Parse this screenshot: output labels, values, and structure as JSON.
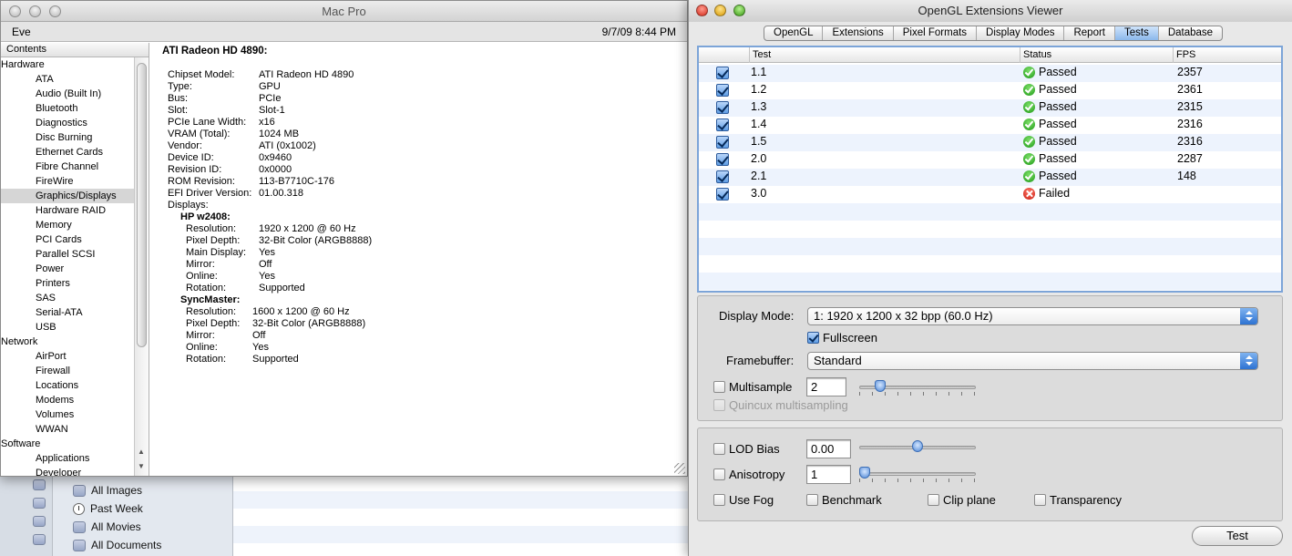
{
  "background_finder": {
    "items": [
      {
        "label": "All Images",
        "icon": "smart-folder-icon"
      },
      {
        "label": "Past Week",
        "icon": "clock-icon"
      },
      {
        "label": "All Movies",
        "icon": "smart-folder-icon"
      },
      {
        "label": "All Documents",
        "icon": "smart-folder-icon"
      }
    ]
  },
  "system_profiler": {
    "title": "Mac Pro",
    "user": "Eve",
    "datetime": "9/7/09 8:44 PM",
    "contents_header": "Contents",
    "sidebar": [
      {
        "label": "Hardware",
        "type": "category"
      },
      {
        "label": "ATA",
        "type": "item"
      },
      {
        "label": "Audio (Built In)",
        "type": "item"
      },
      {
        "label": "Bluetooth",
        "type": "item"
      },
      {
        "label": "Diagnostics",
        "type": "item"
      },
      {
        "label": "Disc Burning",
        "type": "item"
      },
      {
        "label": "Ethernet Cards",
        "type": "item"
      },
      {
        "label": "Fibre Channel",
        "type": "item"
      },
      {
        "label": "FireWire",
        "type": "item"
      },
      {
        "label": "Graphics/Displays",
        "type": "item",
        "selected": true
      },
      {
        "label": "Hardware RAID",
        "type": "item"
      },
      {
        "label": "Memory",
        "type": "item"
      },
      {
        "label": "PCI Cards",
        "type": "item"
      },
      {
        "label": "Parallel SCSI",
        "type": "item"
      },
      {
        "label": "Power",
        "type": "item"
      },
      {
        "label": "Printers",
        "type": "item"
      },
      {
        "label": "SAS",
        "type": "item"
      },
      {
        "label": "Serial-ATA",
        "type": "item"
      },
      {
        "label": "USB",
        "type": "item"
      },
      {
        "label": "Network",
        "type": "category"
      },
      {
        "label": "AirPort",
        "type": "item"
      },
      {
        "label": "Firewall",
        "type": "item"
      },
      {
        "label": "Locations",
        "type": "item"
      },
      {
        "label": "Modems",
        "type": "item"
      },
      {
        "label": "Volumes",
        "type": "item"
      },
      {
        "label": "WWAN",
        "type": "item"
      },
      {
        "label": "Software",
        "type": "category"
      },
      {
        "label": "Applications",
        "type": "item"
      },
      {
        "label": "Developer",
        "type": "item"
      }
    ],
    "detail": {
      "title": "ATI Radeon HD 4890:",
      "rows": [
        {
          "k": "Chipset Model:",
          "v": "ATI Radeon HD 4890"
        },
        {
          "k": "Type:",
          "v": "GPU"
        },
        {
          "k": "Bus:",
          "v": "PCIe"
        },
        {
          "k": "Slot:",
          "v": "Slot-1"
        },
        {
          "k": "PCIe Lane Width:",
          "v": "x16"
        },
        {
          "k": "VRAM (Total):",
          "v": "1024 MB"
        },
        {
          "k": "Vendor:",
          "v": "ATI (0x1002)"
        },
        {
          "k": "Device ID:",
          "v": "0x9460"
        },
        {
          "k": "Revision ID:",
          "v": "0x0000"
        },
        {
          "k": "ROM Revision:",
          "v": "113-B7710C-176"
        },
        {
          "k": "EFI Driver Version:",
          "v": "01.00.318"
        }
      ],
      "displays_label": "Displays:",
      "displays": [
        {
          "name": "HP w2408:",
          "rows": [
            {
              "k": "Resolution:",
              "v": "1920 x 1200 @ 60 Hz"
            },
            {
              "k": "Pixel Depth:",
              "v": "32-Bit Color (ARGB8888)"
            },
            {
              "k": "Main Display:",
              "v": "Yes"
            },
            {
              "k": "Mirror:",
              "v": "Off"
            },
            {
              "k": "Online:",
              "v": "Yes"
            },
            {
              "k": "Rotation:",
              "v": "Supported"
            }
          ]
        },
        {
          "name": "SyncMaster:",
          "rows": [
            {
              "k": "Resolution:",
              "v": "1600 x 1200 @ 60 Hz"
            },
            {
              "k": "Pixel Depth:",
              "v": "32-Bit Color (ARGB8888)"
            },
            {
              "k": "Mirror:",
              "v": "Off"
            },
            {
              "k": "Online:",
              "v": "Yes"
            },
            {
              "k": "Rotation:",
              "v": "Supported"
            }
          ]
        }
      ]
    }
  },
  "opengl": {
    "title": "OpenGL Extensions Viewer",
    "tabs": [
      "OpenGL",
      "Extensions",
      "Pixel Formats",
      "Display Modes",
      "Report",
      "Tests",
      "Database"
    ],
    "active_tab": "Tests",
    "table": {
      "headers": {
        "test": "Test",
        "status": "Status",
        "fps": "FPS"
      },
      "rows": [
        {
          "name": "1.1",
          "status": "Passed",
          "result": "pass",
          "fps": "2357",
          "checked": true
        },
        {
          "name": "1.2",
          "status": "Passed",
          "result": "pass",
          "fps": "2361",
          "checked": true
        },
        {
          "name": "1.3",
          "status": "Passed",
          "result": "pass",
          "fps": "2315",
          "checked": true
        },
        {
          "name": "1.4",
          "status": "Passed",
          "result": "pass",
          "fps": "2316",
          "checked": true
        },
        {
          "name": "1.5",
          "status": "Passed",
          "result": "pass",
          "fps": "2316",
          "checked": true
        },
        {
          "name": "2.0",
          "status": "Passed",
          "result": "pass",
          "fps": "2287",
          "checked": true
        },
        {
          "name": "2.1",
          "status": "Passed",
          "result": "pass",
          "fps": "148",
          "checked": true
        },
        {
          "name": "3.0",
          "status": "Failed",
          "result": "fail",
          "fps": "",
          "checked": true
        }
      ]
    },
    "display_mode": {
      "label": "Display Mode:",
      "value": "1: 1920 x 1200 x 32 bpp (60.0 Hz)"
    },
    "fullscreen": {
      "label": "Fullscreen",
      "checked": true
    },
    "framebuffer": {
      "label": "Framebuffer:",
      "value": "Standard"
    },
    "multisample": {
      "label": "Multisample",
      "checked": false,
      "value": "2",
      "slider_level": 0.15
    },
    "quincux": {
      "label": "Quincux multisampling",
      "enabled": false
    },
    "lod_bias": {
      "label": "LOD Bias",
      "checked": false,
      "value": "0.00",
      "slider_level": 0.5
    },
    "anisotropy": {
      "label": "Anisotropy",
      "checked": false,
      "value": "1",
      "slider_level": 0.0
    },
    "options": [
      {
        "label": "Use Fog",
        "checked": false
      },
      {
        "label": "Benchmark",
        "checked": false
      },
      {
        "label": "Clip plane",
        "checked": false
      },
      {
        "label": "Transparency",
        "checked": false
      }
    ],
    "test_button": "Test",
    "colors": {
      "passed": "#1f9a17",
      "failed": "#c81a10",
      "active_tab": "#8bb8ec",
      "selection": "#7ca4d8"
    }
  }
}
